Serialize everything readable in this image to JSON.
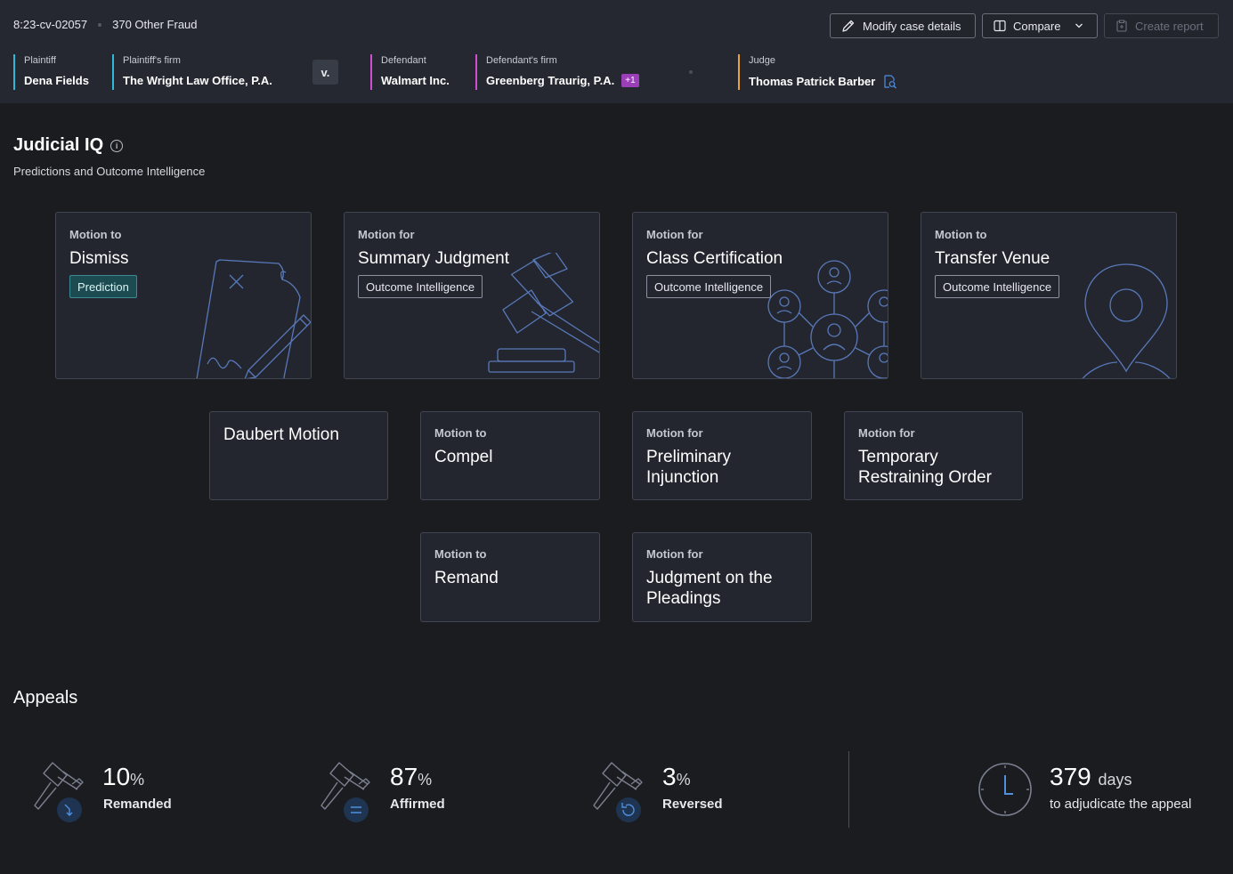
{
  "case": {
    "number": "8:23-cv-02057",
    "type": "370 Other Fraud"
  },
  "toolbar": {
    "modify_label": "Modify case details",
    "compare_label": "Compare",
    "report_label": "Create report"
  },
  "parties": {
    "plaintiff": {
      "label": "Plaintiff",
      "value": "Dena Fields"
    },
    "plaintiff_firm": {
      "label": "Plaintiff's firm",
      "value": "The Wright Law Office, P.A."
    },
    "vs": "v.",
    "defendant": {
      "label": "Defendant",
      "value": "Walmart Inc."
    },
    "defendant_firm": {
      "label": "Defendant's firm",
      "value": "Greenberg Traurig, P.A.",
      "extra": "+1"
    },
    "judge": {
      "label": "Judge",
      "value": "Thomas Patrick Barber"
    }
  },
  "colors": {
    "plaintiff_bar": "#2fb8d8",
    "defendant_bar": "#d04fd0",
    "judge_bar": "#e8a23a",
    "prediction_tag": "#1d4b52",
    "illustration": "#5878b8"
  },
  "judicial_iq": {
    "title": "Judicial IQ",
    "subtitle": "Predictions and Outcome Intelligence",
    "cards": [
      {
        "pre": "Motion to",
        "title": "Dismiss",
        "tag": "Prediction",
        "icon": "document-sign-icon"
      },
      {
        "pre": "Motion for",
        "title": "Summary Judgment",
        "tag": "Outcome Intelligence",
        "icon": "gavel-icon"
      },
      {
        "pre": "Motion for",
        "title": "Class Certification",
        "tag": "Outcome Intelligence",
        "icon": "network-people-icon"
      },
      {
        "pre": "Motion to",
        "title": "Transfer Venue",
        "tag": "Outcome Intelligence",
        "icon": "map-pin-icon"
      },
      {
        "pre": "",
        "title": "Daubert Motion"
      },
      {
        "pre": "Motion to",
        "title": "Compel"
      },
      {
        "pre": "Motion for",
        "title": "Preliminary Injunction"
      },
      {
        "pre": "Motion for",
        "title": "Temporary Restraining Order"
      },
      {
        "pre": "Motion to",
        "title": "Remand"
      },
      {
        "pre": "Motion for",
        "title": "Judgment on the Pleadings"
      }
    ]
  },
  "appeals": {
    "title": "Appeals",
    "remanded": {
      "value": "10",
      "unit": "%",
      "label": "Remanded"
    },
    "affirmed": {
      "value": "87",
      "unit": "%",
      "label": "Affirmed"
    },
    "reversed": {
      "value": "3",
      "unit": "%",
      "label": "Reversed"
    },
    "duration": {
      "value": "379",
      "unit": "days",
      "label": "to adjudicate the appeal"
    }
  }
}
